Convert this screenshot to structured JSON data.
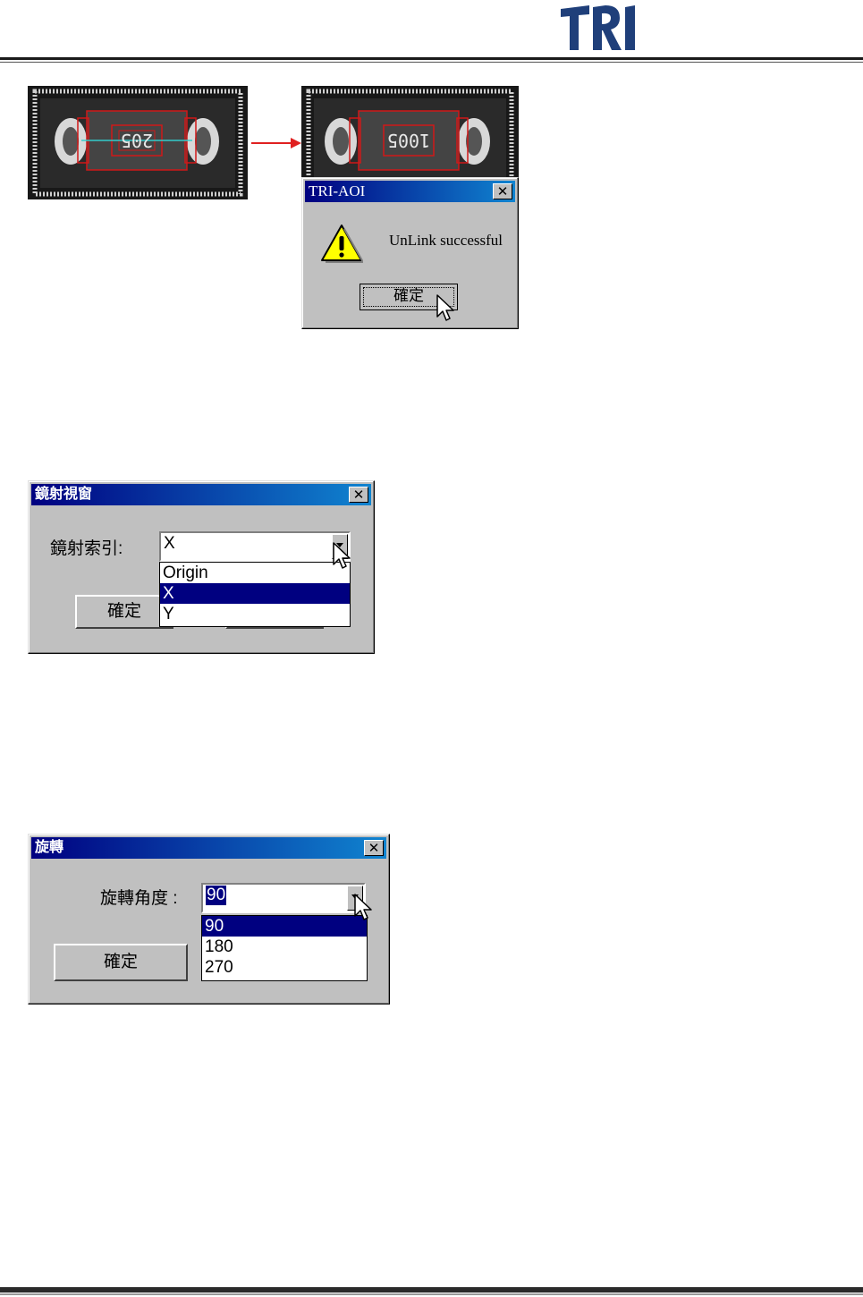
{
  "header": {
    "logo_text": "TRI"
  },
  "unlink": {
    "dialog_title": "TRI-AOI",
    "message": "UnLink successful",
    "ok_label": "確定",
    "close_glyph": "✕",
    "left_chip_text": "205",
    "right_chip_text": "1005"
  },
  "mirror": {
    "dialog_title": "鏡射視窗",
    "field_label": "鏡射索引:",
    "selected_value": "X",
    "options": [
      "Origin",
      "X",
      "Y"
    ],
    "ok_label": "確定",
    "close_glyph": "✕"
  },
  "rotate": {
    "dialog_title": "旋轉",
    "field_label": "旋轉角度 :",
    "selected_value": "90",
    "options": [
      "90",
      "180",
      "270"
    ],
    "ok_label": "確定",
    "close_glyph": "✕"
  },
  "colors": {
    "title_start": "#000080",
    "title_end": "#1084d0",
    "selection": "#000080",
    "arrow": "#e02020",
    "box": "#d01818"
  }
}
